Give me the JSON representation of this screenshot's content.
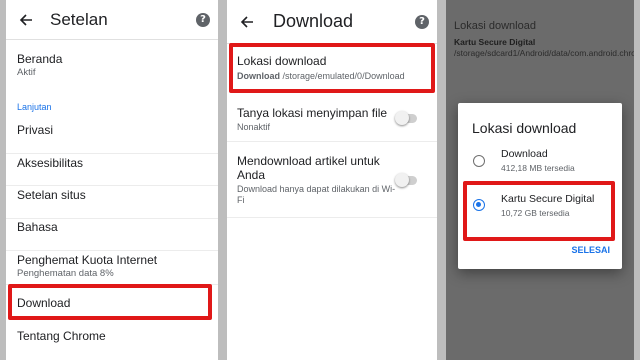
{
  "settings": {
    "title": "Setelan",
    "home": {
      "title": "Beranda",
      "sub": "Aktif"
    },
    "advanced_label": "Lanjutan",
    "privacy": "Privasi",
    "accessibility": "Aksesibilitas",
    "site_settings": "Setelan situs",
    "language": "Bahasa",
    "data_saver": {
      "title": "Penghemat Kuota Internet",
      "sub": "Penghematan data 8%"
    },
    "download": "Download",
    "about": "Tentang Chrome"
  },
  "download_page": {
    "title": "Download",
    "location": {
      "title": "Lokasi download",
      "sub_bold": "Download",
      "sub_path": "/storage/emulated/0/Download"
    },
    "ask_location": {
      "title": "Tanya lokasi menyimpan file",
      "sub": "Nonaktif"
    },
    "articles": {
      "title": "Mendownload artikel untuk Anda",
      "sub": "Download hanya dapat dilakukan di Wi-Fi"
    }
  },
  "location_dialog_page": {
    "bg_title": "Lokasi download",
    "bg_sub_bold": "Kartu Secure Digital",
    "bg_sub_path": "/storage/sdcard1/Android/data/com.android.chrome/files/Download",
    "dialog": {
      "title": "Lokasi download",
      "options": [
        {
          "title": "Download",
          "sub": "412,18 MB tersedia",
          "selected": false
        },
        {
          "title": "Kartu Secure Digital",
          "sub": "10,72 GB tersedia",
          "selected": true
        }
      ],
      "done": "SELESAI"
    }
  },
  "icons": {
    "back": "arrow-left-icon",
    "help": "help-icon"
  },
  "colors": {
    "highlight": "#e01818",
    "accent": "#1a73e8",
    "background": "#bdbdbd",
    "scrim": "#6b6b6b"
  }
}
